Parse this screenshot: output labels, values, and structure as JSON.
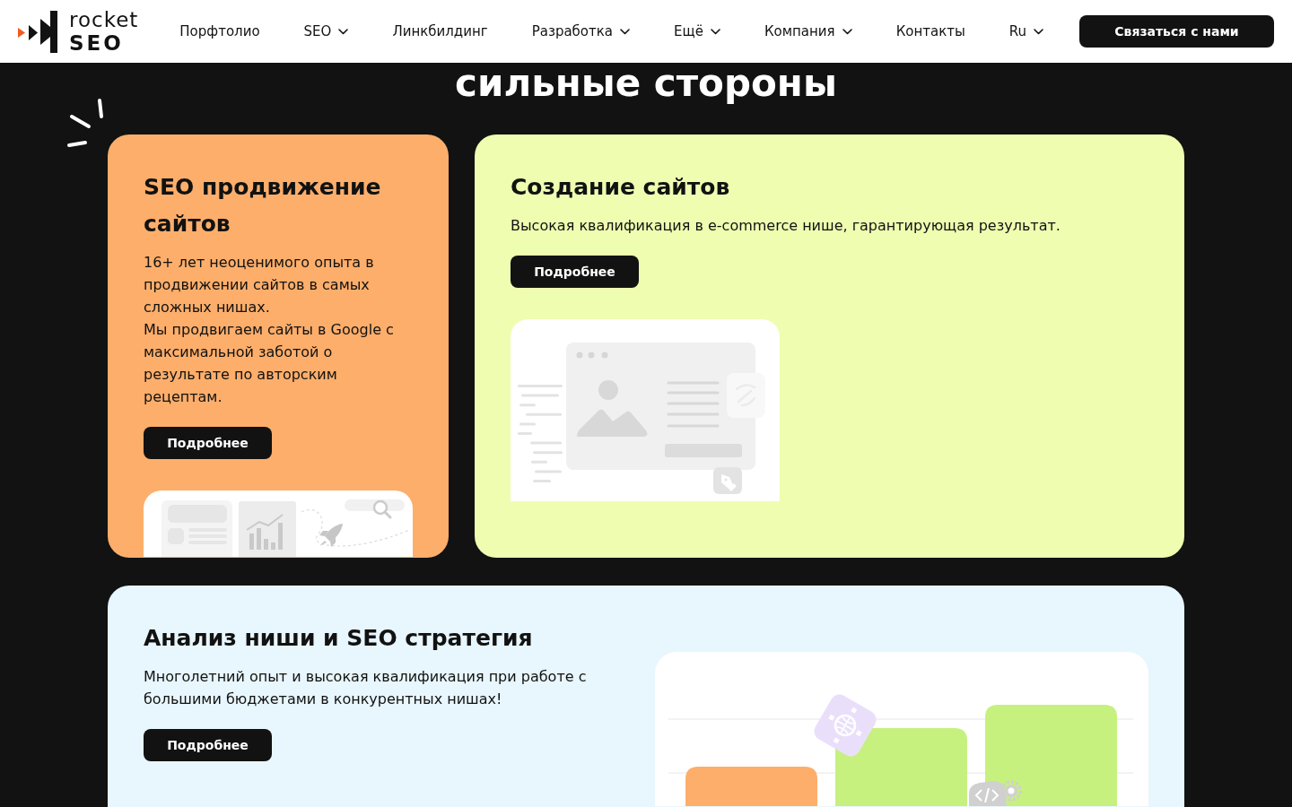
{
  "header": {
    "logo": {
      "line_1": "rocket",
      "line_2": "SEO"
    },
    "nav": [
      {
        "label": "Порфтолио",
        "dropdown": false
      },
      {
        "label": "SEO",
        "dropdown": true
      },
      {
        "label": "Линкбилдинг",
        "dropdown": false
      },
      {
        "label": "Разработка",
        "dropdown": true
      },
      {
        "label": "Ещё",
        "dropdown": true
      },
      {
        "label": "Компания",
        "dropdown": true
      },
      {
        "label": "Контакты",
        "dropdown": false
      },
      {
        "label": "Ru",
        "dropdown": true
      }
    ],
    "contact_button": "Связаться с нами"
  },
  "section": {
    "title": "сильные стороны",
    "cards": [
      {
        "kind": "column",
        "color": "#fdae6b",
        "title": "SEO продвижение сайтов",
        "paragraphs": [
          "16+ лет неоценимого опыта в продвижении сайтов в самых сложных нишах.",
          "Мы продвигаем сайты в Google с максимальной заботой о результате по авторским рецептам."
        ],
        "button": "Подробнее"
      },
      {
        "kind": "column",
        "color": "#effdb1",
        "title": "Создание сайтов",
        "paragraphs": [
          "Высокая квалификация в e-commerce нише, гарантирующая результат."
        ],
        "button": "Подробнее"
      },
      {
        "kind": "wide",
        "color": "#e8f6fe",
        "title": "Анализ ниши и SEO стратегия",
        "paragraphs": [
          "Многолетний опыт и высокая квалификация при работе с большими бюджетами в конкурентных нишах!"
        ],
        "button": "Подробнее"
      }
    ]
  }
}
